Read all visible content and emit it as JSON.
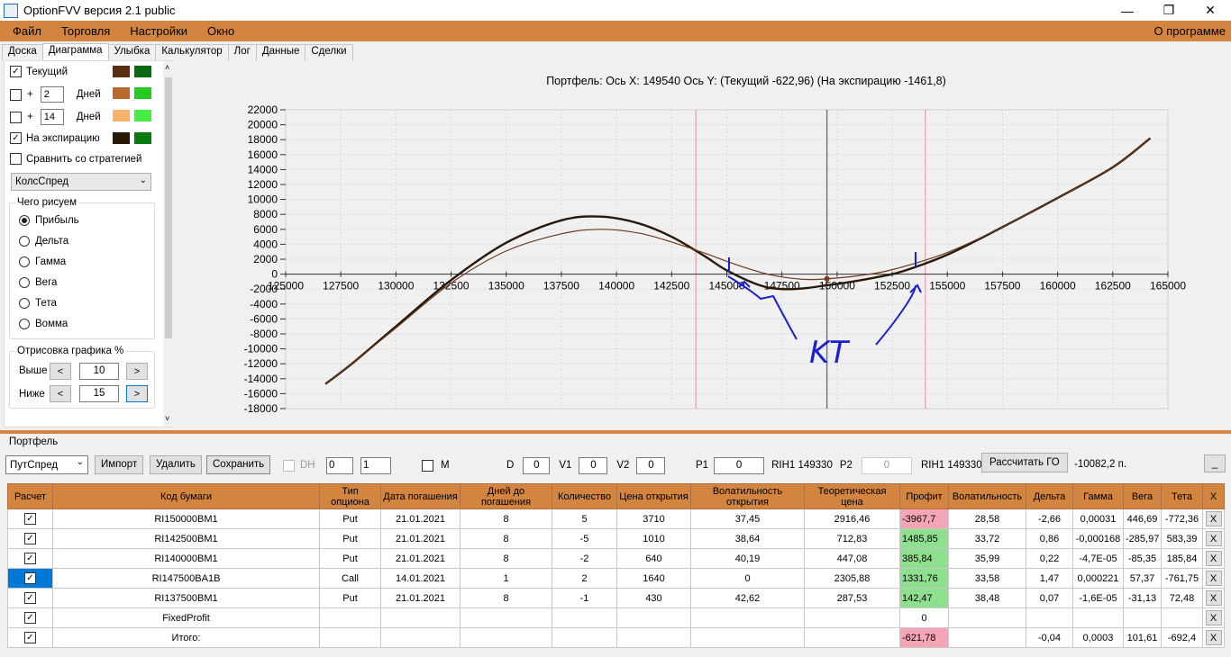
{
  "window": {
    "title": "OptionFVV версия 2.1 public",
    "min": "—",
    "restore": "❐",
    "close": "✕"
  },
  "menu": {
    "items": [
      "Файл",
      "Торговля",
      "Настройки",
      "Окно"
    ],
    "about": "О программе"
  },
  "tabs": [
    "Доска",
    "Диаграмма",
    "Улыбка",
    "Калькулятор",
    "Лог",
    "Данные",
    "Сделки"
  ],
  "active_tab": "Диаграмма",
  "left": {
    "current_label": "Текущий",
    "plus": "+",
    "days_label": "Дней",
    "days1": "2",
    "days2": "14",
    "expiry_label": "На экспирацию",
    "compare_label": "Сравнить со стратегией",
    "strategy": "КолсСпред",
    "what_group": "Чего рисуем",
    "radios": [
      "Прибыль",
      "Дельта",
      "Гамма",
      "Вега",
      "Тета",
      "Вомма"
    ],
    "draw_group": "Отрисовка графика %",
    "above_label": "Выше",
    "below_label": "Ниже",
    "above_val": "10",
    "below_val": "15",
    "lt": "<",
    "gt": ">",
    "swatch_colors": [
      "#5c2f12",
      "#0b6b12",
      "#b86a2e",
      "#22cc22",
      "#f7b36a",
      "#44ee44",
      "#2a1808",
      "#0a7a12"
    ]
  },
  "chart_data": {
    "type": "line",
    "title": "Портфель: Ось X: 149540 Ось Y:  (Текущий -622,96)  (На экспирацию -1461,8)",
    "x_ticks": [
      "125000",
      "127500",
      "130000",
      "132500",
      "135000",
      "137500",
      "140000",
      "142500",
      "145000",
      "147500",
      "150000",
      "152500",
      "155000",
      "157500",
      "160000",
      "162500",
      "165000"
    ],
    "y_ticks": [
      "22000",
      "20000",
      "18000",
      "16000",
      "14000",
      "12000",
      "10000",
      "8000",
      "6000",
      "4000",
      "2000",
      "0",
      "-2000",
      "-4000",
      "-6000",
      "-8000",
      "-10000",
      "-12000",
      "-14000",
      "-16000",
      "-18000"
    ],
    "xlim": [
      125000,
      165000
    ],
    "ylim": [
      -18000,
      22000
    ],
    "grid": true,
    "series": [
      {
        "name": "На экспирацию",
        "color": "#2a1808",
        "x": [
          126800,
          128000,
          130000,
          132500,
          135000,
          137500,
          139300,
          141000,
          142500,
          144000,
          145000,
          146500,
          147500,
          148500,
          149500,
          150500,
          152000,
          153000,
          155000,
          157500,
          160000,
          162500,
          164200
        ],
        "y": [
          -14700,
          -12000,
          -7000,
          -800,
          4200,
          7200,
          7700,
          6800,
          5000,
          2400,
          500,
          -1500,
          -2000,
          -1900,
          -1500,
          -1100,
          -300,
          400,
          2600,
          6300,
          10200,
          14300,
          18200
        ]
      },
      {
        "name": "Текущий",
        "color": "#6b3a1a",
        "x": [
          126800,
          128000,
          130000,
          132500,
          135000,
          137500,
          139300,
          141000,
          142500,
          144000,
          145500,
          147000,
          148500,
          149540,
          151000,
          152500,
          155000,
          157500,
          160000,
          162500,
          164200
        ],
        "y": [
          -14700,
          -12000,
          -7200,
          -1200,
          3100,
          5400,
          6000,
          5500,
          4300,
          2800,
          1200,
          -100,
          -700,
          -623,
          -200,
          600,
          2900,
          6300,
          10200,
          14300,
          18200
        ]
      }
    ],
    "cursor_x": 149540,
    "bound_lines": [
      143600,
      154000
    ]
  },
  "annotation": {
    "text": "KT"
  },
  "portfolio": {
    "label": "Портфель",
    "select": "ПутСпред",
    "import": "Импорт",
    "delete": "Удалить",
    "save": "Сохранить",
    "dh": "DH",
    "spin1": "0",
    "spin2": "1",
    "m": "M",
    "d_label": "D",
    "d_val": "0",
    "v1_label": "V1",
    "v1_val": "0",
    "v2_label": "V2",
    "v2_val": "0",
    "p1_label": "P1",
    "p1_val": "0",
    "rih1a": "RIH1 149330",
    "p2_label": "P2",
    "p2_val": "0",
    "rih1b": "RIH1 149330",
    "calc_go": "Рассчитать ГО",
    "go_val": "-10082,2 п.",
    "minimize": "_"
  },
  "table": {
    "headers": [
      "Расчет",
      "Код бумаги",
      "Тип опциона",
      "Дата погашения",
      "Дней до погашения",
      "Количество",
      "Цена открытия",
      "Волатильность открытия",
      "Теоретическая цена",
      "Профит",
      "Волатильность",
      "Дельта",
      "Гамма",
      "Вега",
      "Тета",
      "X"
    ],
    "rows": [
      [
        "RI150000BM1",
        "Put",
        "21.01.2021",
        "8",
        "5",
        "3710",
        "37,45",
        "2916,46",
        "-3967,7",
        "28,58",
        "-2,66",
        "0,00031",
        "446,69",
        "-772,36"
      ],
      [
        "RI142500BM1",
        "Put",
        "21.01.2021",
        "8",
        "-5",
        "1010",
        "38,64",
        "712,83",
        "1485,85",
        "33,72",
        "0,86",
        "-0,000168",
        "-285,97",
        "583,39"
      ],
      [
        "RI140000BM1",
        "Put",
        "21.01.2021",
        "8",
        "-2",
        "640",
        "40,19",
        "447,08",
        "385,84",
        "35,99",
        "0,22",
        "-4,7E-05",
        "-85,35",
        "185,84"
      ],
      [
        "RI147500BA1B",
        "Call",
        "14.01.2021",
        "1",
        "2",
        "1640",
        "0",
        "2305,88",
        "1331,76",
        "33,58",
        "1,47",
        "0,000221",
        "57,37",
        "-761,75"
      ],
      [
        "RI137500BM1",
        "Put",
        "21.01.2021",
        "8",
        "-1",
        "430",
        "42,62",
        "287,53",
        "142,47",
        "38,48",
        "0,07",
        "-1,6E-05",
        "-31,13",
        "72,48"
      ]
    ],
    "fixed_label": "FixedProfit",
    "fixed_profit": "0",
    "total_label": "Итого:",
    "total_profit": "-621,78",
    "total_delta": "-0,04",
    "total_gamma": "0,0003",
    "total_vega": "101,61",
    "total_theta": "-692,4",
    "x": "X",
    "check": "✓",
    "profit_colors": {
      "neg": "#f4a6b6",
      "pos": "#8ee08e"
    }
  }
}
